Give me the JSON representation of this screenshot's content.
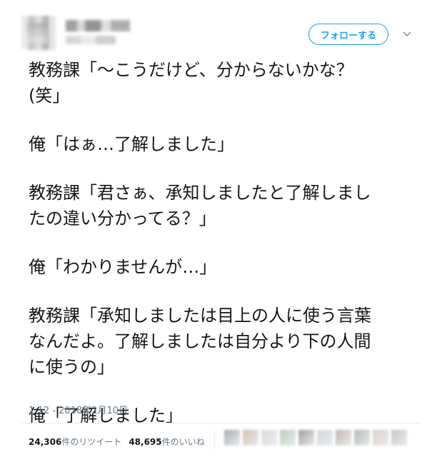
{
  "header": {
    "follow_label": "フォローする",
    "avatar_icon": "user-avatar-icon",
    "more_icon": "chevron-down-icon",
    "accent_color": "#1da1f2"
  },
  "tweet": {
    "paragraphs": [
      [
        "教務課「〜こうだけど、分からないかな？",
        "(笑」"
      ],
      [
        "俺「はぁ…了解しました」"
      ],
      [
        "教務課「君さぁ、承知しましたと了解しまし",
        "たの違い分かってる？」"
      ],
      [
        "俺「わかりませんが…」"
      ],
      [
        "教務課「承知しましたは目上の人に使う言葉",
        "なんだよ。了解しましたは自分より下の人間",
        "に使うの」"
      ],
      [
        "俺「了解しました」"
      ]
    ],
    "timestamp": "1:12 - 2018年2月10日"
  },
  "stats": {
    "retweet_count": "24,306",
    "retweet_label": "件のリツイート",
    "like_count": "48,695",
    "like_label": "件のいいね"
  },
  "likers": [
    {
      "color": "#9aa0a6"
    },
    {
      "color": "#c9b6a5"
    },
    {
      "color": "#d6d6d6"
    },
    {
      "color": "#b0c4b1"
    },
    {
      "color": "#8d8d8d"
    },
    {
      "color": "#c7d0d8"
    },
    {
      "color": "#b8a9a0"
    },
    {
      "color": "#a4b0a8"
    },
    {
      "color": "#d9c6bd"
    },
    {
      "color": "#bdbdbd"
    }
  ]
}
